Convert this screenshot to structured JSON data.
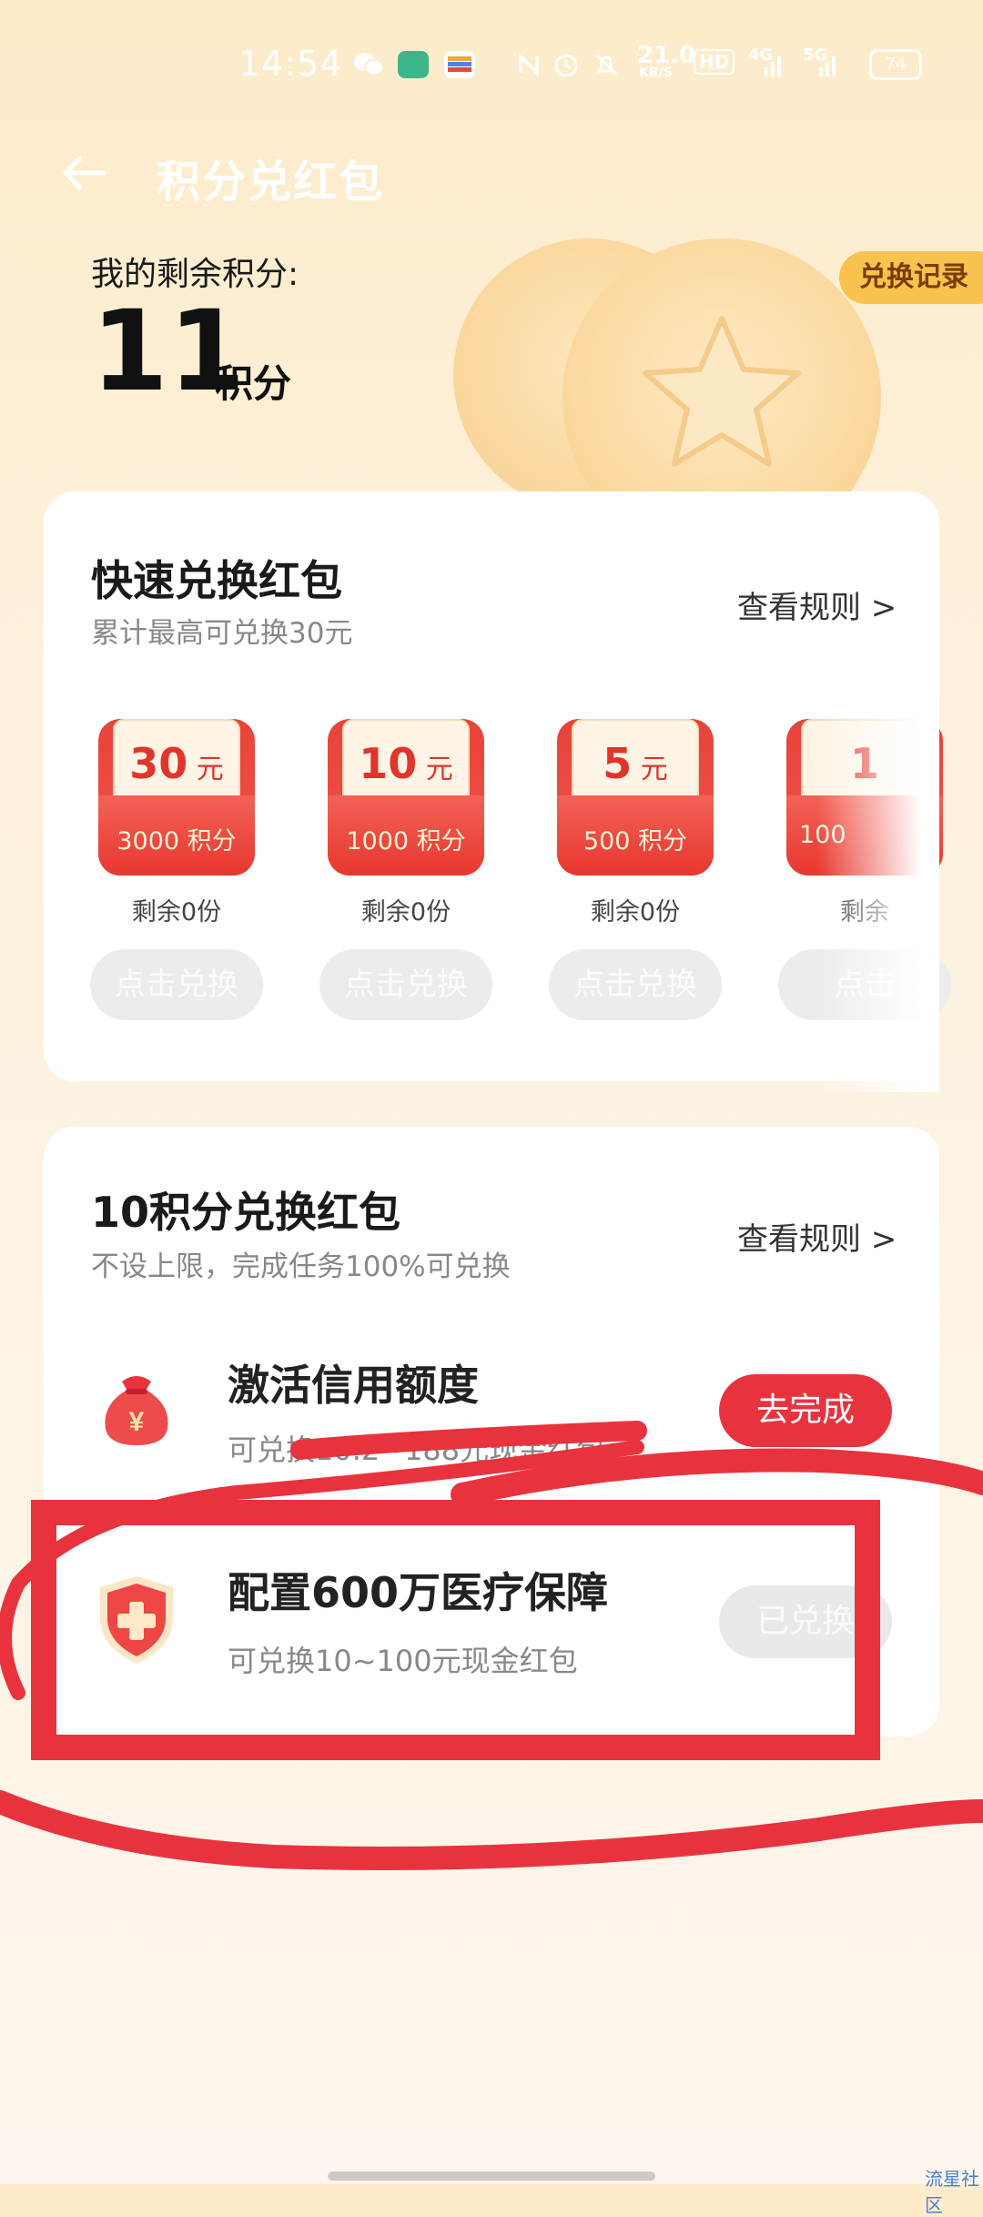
{
  "status_bar": {
    "time": "14:54",
    "speed": "21.0",
    "speed_unit": "KB/S",
    "hd": "HD",
    "net1": "4G",
    "net2": "5G",
    "battery": "74"
  },
  "header": {
    "title": "积分兑红包",
    "points_label": "我的剩余积分:",
    "points_value": "11",
    "points_unit": "积分",
    "record_button": "兑换记录"
  },
  "quick": {
    "title": "快速兑换红包",
    "subtitle": "累计最高可兑换30元",
    "rules": "查看规则 >",
    "items": [
      {
        "amount": "30",
        "unit": "元",
        "cost": "3000 积分",
        "remain": "剩余0份",
        "button": "点击兑换"
      },
      {
        "amount": "10",
        "unit": "元",
        "cost": "1000 积分",
        "remain": "剩余0份",
        "button": "点击兑换"
      },
      {
        "amount": "5",
        "unit": "元",
        "cost": "500 积分",
        "remain": "剩余0份",
        "button": "点击兑换"
      },
      {
        "amount": "1",
        "unit": "",
        "cost": "100",
        "remain": "剩余",
        "button": "点击"
      }
    ]
  },
  "tasks": {
    "title": "10积分兑换红包",
    "subtitle": "不设上限，完成任务100%可兑换",
    "rules": "查看规则 >",
    "items": [
      {
        "name": "激活信用额度",
        "desc": "可兑换10.2~188元现金红包",
        "button": "去完成",
        "icon": "money-bag-icon"
      },
      {
        "name": "配置600万医疗保障",
        "desc": "可兑换10~100元现金红包",
        "button": "已兑换",
        "icon": "medical-shield-icon"
      }
    ]
  },
  "watermark": "流星社区",
  "colors": {
    "accent_red": "#e8333f",
    "annotation_red": "#e8333f",
    "badge_gold": "#f9c24d"
  }
}
